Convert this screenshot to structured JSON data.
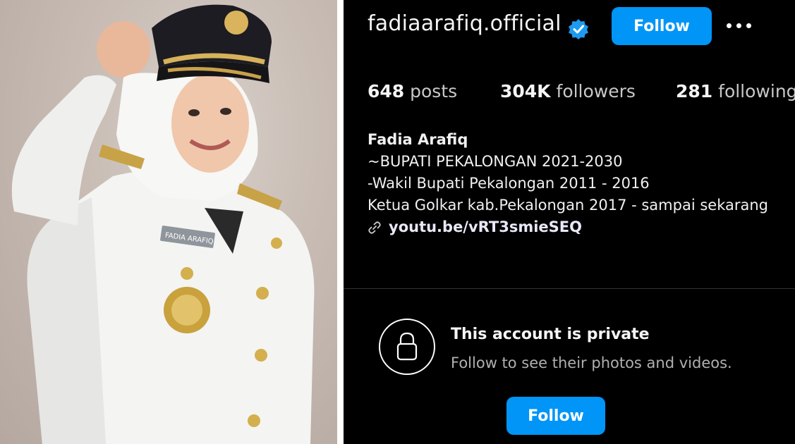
{
  "photo": {
    "name_tag": "FADIA ARAFIQ"
  },
  "profile": {
    "username": "fadiaarafiq.official",
    "verified": true,
    "follow_label": "Follow",
    "more_icon": "more-horizontal-icon"
  },
  "stats": [
    {
      "value": "648",
      "label": "posts"
    },
    {
      "value": "304K",
      "label": "followers"
    },
    {
      "value": "281",
      "label": "following"
    }
  ],
  "bio": {
    "name": "Fadia Arafiq",
    "lines": [
      "~BUPATI PEKALONGAN 2021-2030",
      "-Wakil Bupati Pekalongan 2011 - 2016",
      "Ketua Golkar kab.Pekalongan 2017 - sampai sekarang"
    ],
    "link": "youtu.be/vRT3smieSEQ"
  },
  "private": {
    "title": "This account is private",
    "subtitle": "Follow to see their photos and videos.",
    "follow_label": "Follow"
  },
  "colors": {
    "accent": "#0095f6",
    "background": "#000000"
  }
}
